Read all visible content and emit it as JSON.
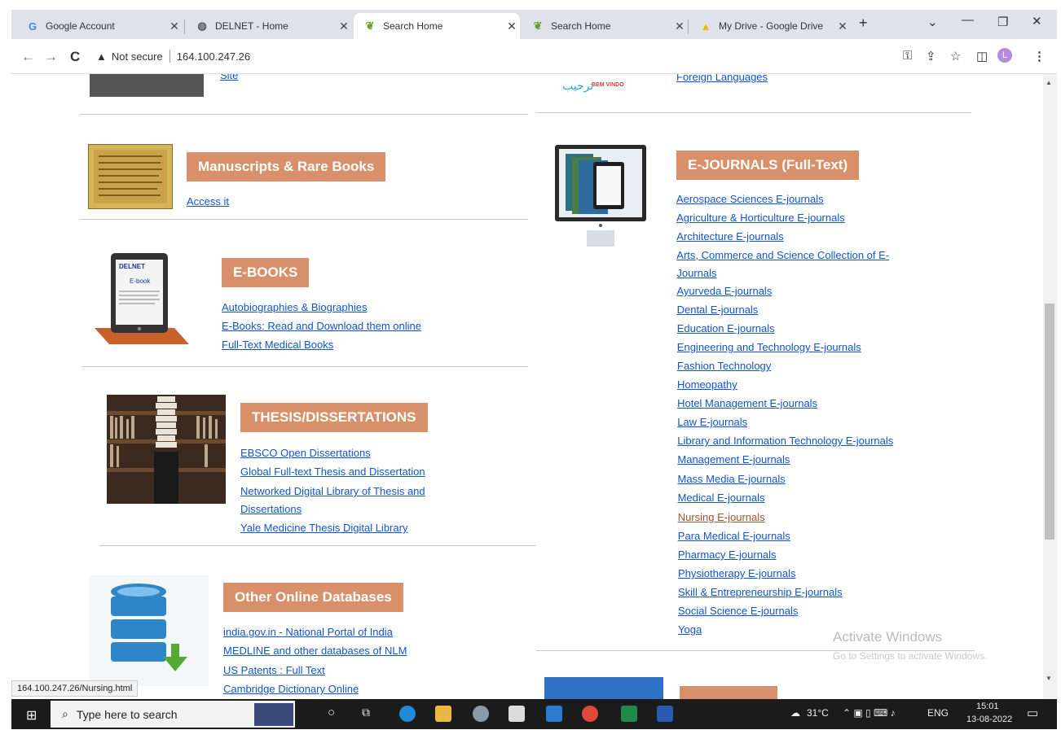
{
  "tabs": [
    {
      "title": "Google Account",
      "icon": "google-icon"
    },
    {
      "title": "DELNET - Home",
      "icon": "globe-icon"
    },
    {
      "title": "Search Home",
      "icon": "leaf-icon"
    },
    {
      "title": "Search Home",
      "icon": "leaf-icon"
    },
    {
      "title": "My Drive - Google Drive",
      "icon": "drive-icon"
    }
  ],
  "address": {
    "security": "Not secure",
    "url": "164.100.247.26"
  },
  "top_partial": {
    "left_link": "Site",
    "right_link": "Foreign Languages",
    "welcome": "BEM VINDO",
    "welcome_arabic": "ترحيب"
  },
  "manuscripts": {
    "title": "Manuscripts & Rare Books",
    "links": [
      "Access it"
    ]
  },
  "ebooks": {
    "title": "E-BOOKS",
    "device_brand": "DELNET",
    "device_label": "E-book",
    "links": [
      "Autobiographies & Biographies",
      "E-Books: Read and Download them online",
      "Full-Text Medical Books"
    ]
  },
  "thesis": {
    "title": "THESIS/DISSERTATIONS",
    "links": [
      "EBSCO Open Dissertations",
      "Global Full-text Thesis and Dissertation",
      "Networked Digital Library of Thesis and",
      "Dissertations",
      "Yale Medicine Thesis Digital Library"
    ]
  },
  "databases": {
    "title": "Other Online Databases",
    "links": [
      "india.gov.in - National Portal of India",
      "MEDLINE and other databases of NLM",
      "US Patents : Full Text",
      "Cambridge Dictionary Online"
    ]
  },
  "ejournals": {
    "title": "E-JOURNALS (Full-Text)",
    "links": [
      "Aerospace Sciences E-journals",
      "Agriculture & Horticulture E-journals",
      "Architecture E-journals",
      "Arts, Commerce and Science Collection of E-",
      "Journals",
      "Ayurveda E-journals",
      "Dental E-journals",
      "Education E-journals",
      "Engineering and Technology E-journals",
      "Fashion Technology",
      "Homeopathy",
      "Hotel Management E-journals",
      "Law E-journals",
      "Library and Information Technology E-journals",
      "Management E-journals",
      "Mass Media E-journals",
      "Medical E-journals",
      "Nursing E-journals",
      "Para Medical E-journals",
      "Pharmacy E-journals",
      "Physiotherapy E-journals",
      "Skill & Entrepreneurship E-journals",
      "Social Science E-journals",
      "Yoga"
    ]
  },
  "watermark": {
    "line1": "Activate Windows",
    "line2": "Go to Settings to activate Windows."
  },
  "status_url": "164.100.247.26/Nursing.html",
  "taskbar": {
    "search_placeholder": "Type here to search",
    "temperature": "31°C",
    "language": "ENG",
    "time": "15:01",
    "date": "13-08-2022"
  },
  "colors": {
    "accent": "#d8906a",
    "link": "#1155cc",
    "visited": "#a0522d",
    "tab_bar": "#dfe3e9"
  }
}
